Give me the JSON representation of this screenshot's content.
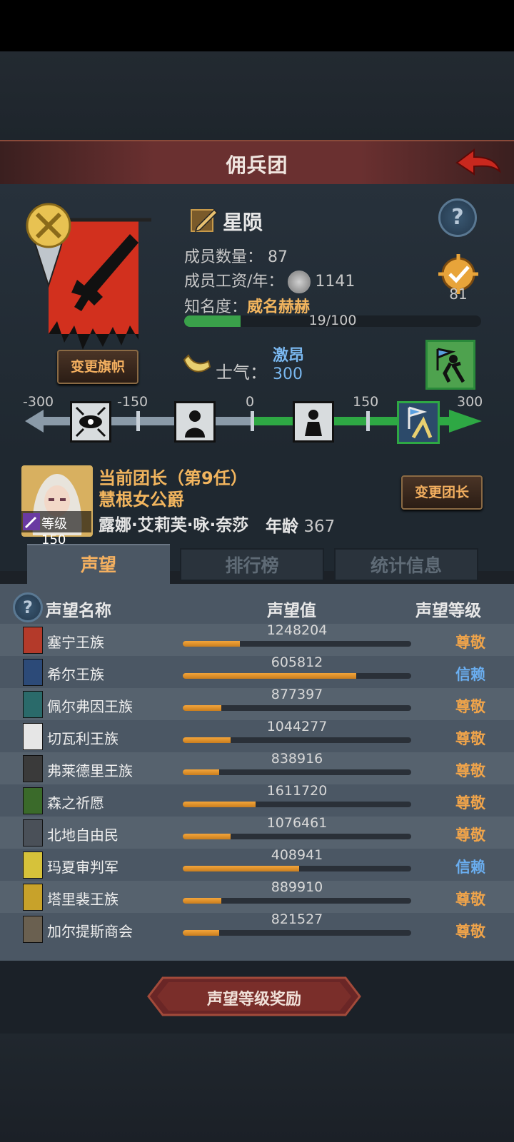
{
  "header": {
    "title": "佣兵团"
  },
  "company": {
    "name": "星陨",
    "members_label": "成员数量：",
    "members_value": "87",
    "wage_label": "成员工资/年：",
    "wage_value": "1141",
    "fame_label": "知名度：",
    "fame_value": "威名赫赫",
    "fame_progress": "19/100",
    "fame_fraction": 0.19,
    "badge_value": "81",
    "change_banner_label": "变更旗帜"
  },
  "morale": {
    "label": "士气：",
    "state": "激昂",
    "value": "300",
    "ticks": [
      "-300",
      "-150",
      "0",
      "150",
      "300"
    ]
  },
  "leader": {
    "title": "当前团长（第9任）",
    "rank": "慧根女公爵",
    "level_label": "等级150",
    "name": "露娜·艾莉芙·咏·奈莎",
    "age_label": "年龄",
    "age_value": "367",
    "change_label": "变更团长"
  },
  "tabs": [
    "声望",
    "排行榜",
    "统计信息"
  ],
  "table": {
    "headers": [
      "声望名称",
      "声望值",
      "声望等级"
    ],
    "rows": [
      {
        "name": "塞宁王族",
        "value": "1248204",
        "level": "尊敬",
        "fill": 0.25,
        "crest": "#b43a2a"
      },
      {
        "name": "希尔王族",
        "value": "605812",
        "level": "信赖",
        "fill": 0.76,
        "crest": "#2c4a78"
      },
      {
        "name": "佩尔弗因王族",
        "value": "877397",
        "level": "尊敬",
        "fill": 0.17,
        "crest": "#2a6a6a"
      },
      {
        "name": "切瓦利王族",
        "value": "1044277",
        "level": "尊敬",
        "fill": 0.21,
        "crest": "#e6e6e6"
      },
      {
        "name": "弗莱德里王族",
        "value": "838916",
        "level": "尊敬",
        "fill": 0.16,
        "crest": "#3a3a3a"
      },
      {
        "name": "森之祈愿",
        "value": "1611720",
        "level": "尊敬",
        "fill": 0.32,
        "crest": "#3a6a2a"
      },
      {
        "name": "北地自由民",
        "value": "1076461",
        "level": "尊敬",
        "fill": 0.21,
        "crest": "#4a5058"
      },
      {
        "name": "玛夏审判军",
        "value": "408941",
        "level": "信赖",
        "fill": 0.51,
        "crest": "#d6c23a"
      },
      {
        "name": "塔里裴王族",
        "value": "889910",
        "level": "尊敬",
        "fill": 0.17,
        "crest": "#c8a22a"
      },
      {
        "name": "加尔提斯商会",
        "value": "821527",
        "level": "尊敬",
        "fill": 0.16,
        "crest": "#6a6050"
      }
    ]
  },
  "footer": {
    "reward_label": "声望等级奖励"
  },
  "colors": {
    "respect": "#f0a44a",
    "trust": "#6aaef0"
  }
}
